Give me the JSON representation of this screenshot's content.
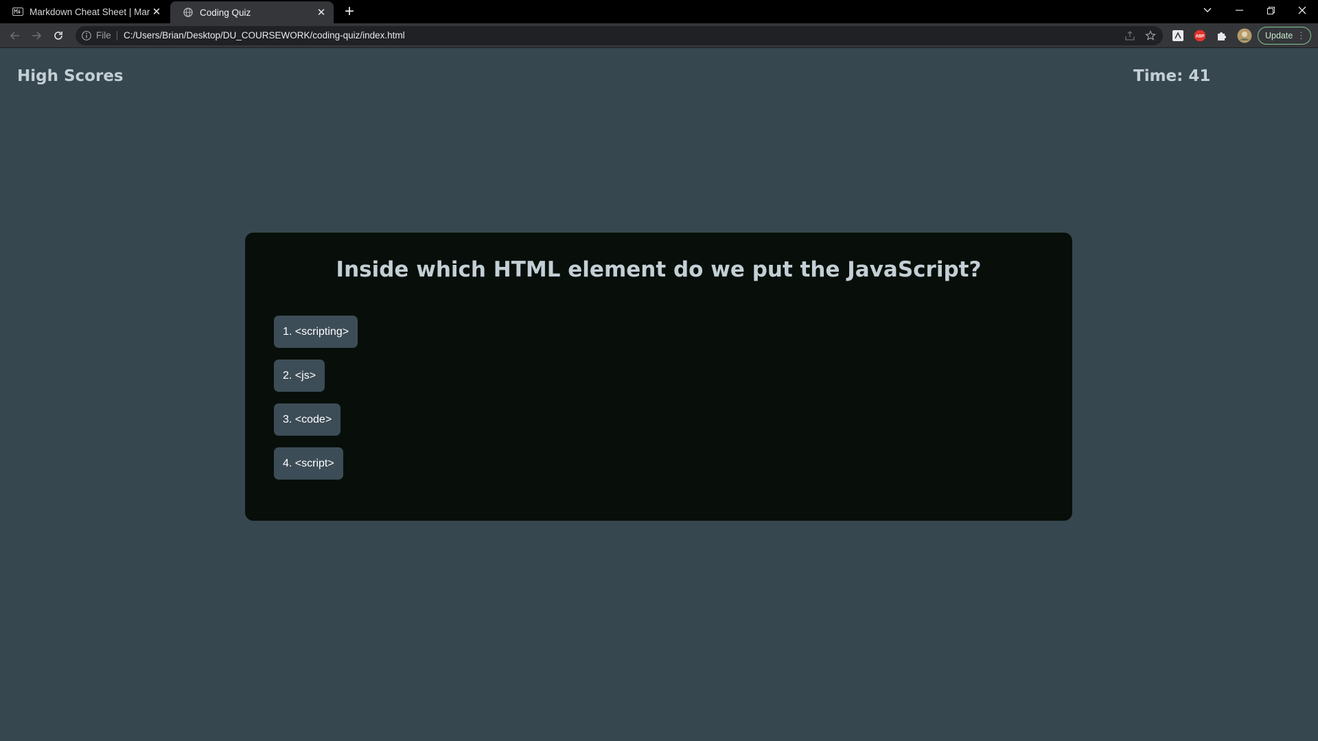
{
  "browser": {
    "tabs": [
      {
        "title": "Markdown Cheat Sheet | Markdown",
        "active": false,
        "icon": "markdown-icon"
      },
      {
        "title": "Coding Quiz",
        "active": true,
        "icon": "globe-icon"
      }
    ],
    "address_bar": {
      "scheme_label": "File",
      "url": "C:/Users/Brian/Desktop/DU_COURSEWORK/coding-quiz/index.html"
    },
    "update_label": "Update"
  },
  "page": {
    "high_scores_label": "High Scores",
    "timer_text": "Time: 41",
    "question": "Inside which HTML element do we put the JavaScript?",
    "answers": [
      "1. <scripting>",
      "2. <js>",
      "3. <code>",
      "4. <script>"
    ]
  },
  "colors": {
    "page_background": "#37474f",
    "card_background": "#080f0a",
    "button_background": "#3d4d57",
    "heading_text": "#c3cfd5"
  }
}
